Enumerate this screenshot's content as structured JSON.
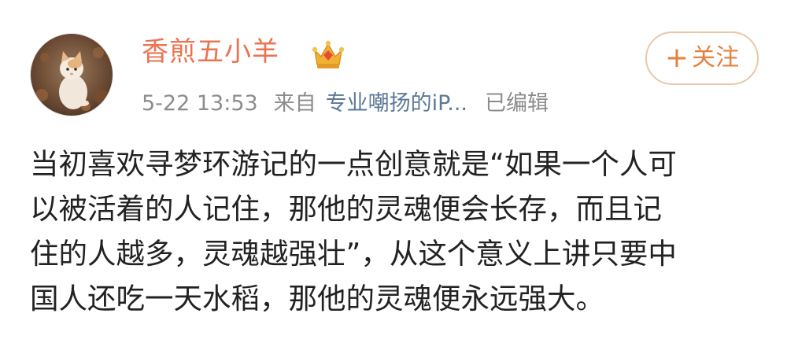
{
  "post": {
    "author": {
      "name": "香煎五小羊",
      "avatar": "avatar-image",
      "badge": "crown-icon"
    },
    "meta": {
      "time": "5-22 13:53",
      "from_label": "来自",
      "source": "专业嘲扬的iP...",
      "edited_label": "已编辑"
    },
    "follow_button": {
      "icon": "plus-icon",
      "plus": "+",
      "label": "关注"
    },
    "body_lines": [
      "当初喜欢寻梦环游记的一点创意就是“如果一个人可",
      "以被活着的人记住，那他的灵魂便会长存，而且记",
      "住的人越多，灵魂越强壮”，从这个意义上讲只要中",
      "国人还吃一天水稻，那他的灵魂便永远强大。"
    ]
  },
  "colors": {
    "username": "#eb7350",
    "meta_text": "#8c8c8c",
    "source_link": "#5d7897",
    "follow_text": "#e2823d",
    "follow_border": "#e8c8a9",
    "body_text": "#222222"
  }
}
